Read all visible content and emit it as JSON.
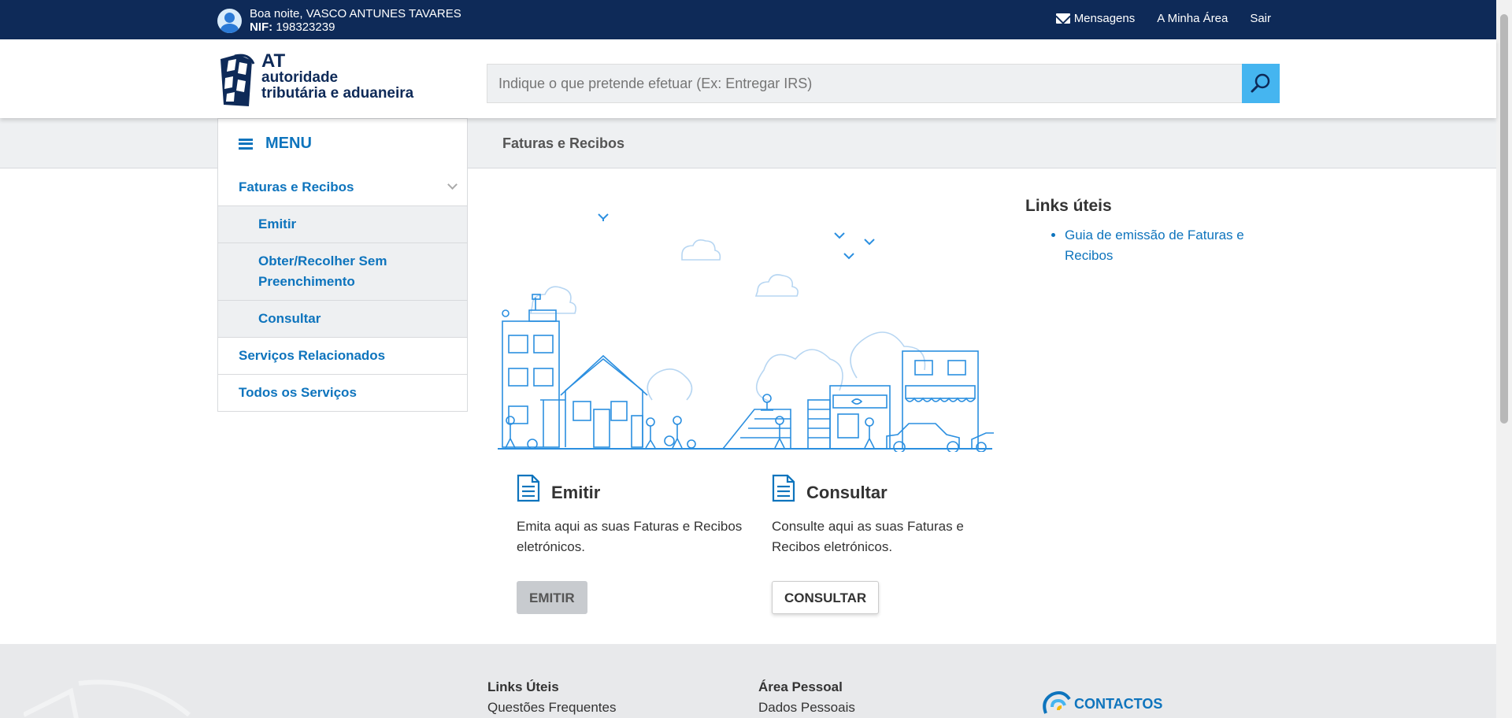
{
  "topbar": {
    "greeting": "Boa noite, VASCO ANTUNES TAVARES",
    "nif_label": "NIF:",
    "nif_value": "198323239",
    "links": {
      "messages": "Mensagens",
      "my_area": "A Minha Área",
      "logout": "Sair"
    }
  },
  "logo": {
    "line1": "AT",
    "line2": "autoridade",
    "line3": "tributária e aduaneira"
  },
  "search": {
    "placeholder": "Indique o que pretende efetuar (Ex: Entregar IRS)"
  },
  "menu": {
    "label": "MENU"
  },
  "breadcrumb": "Faturas e Recibos",
  "sidemenu": [
    {
      "label": "Faturas e Recibos"
    },
    {
      "label": "Emitir"
    },
    {
      "label": "Obter/Recolher Sem Preenchimento"
    },
    {
      "label": "Consultar"
    },
    {
      "label": "Serviços Relacionados"
    },
    {
      "label": "Todos os Serviços"
    }
  ],
  "cards": [
    {
      "title": "Emitir",
      "desc": "Emita aqui as suas Faturas e Recibos eletrónicos.",
      "button": "EMITIR"
    },
    {
      "title": "Consultar",
      "desc": "Consulte aqui as suas Faturas e Recibos eletrónicos.",
      "button": "CONSULTAR"
    }
  ],
  "useful_links": {
    "title": "Links úteis",
    "items": [
      "Guia de emissão de Faturas e Recibos"
    ]
  },
  "footer": {
    "col1": {
      "title": "Links Úteis",
      "item": "Questões Frequentes"
    },
    "col2": {
      "title": "Área Pessoal",
      "item": "Dados Pessoais"
    },
    "contacts": "CONTACTOS"
  },
  "colors": {
    "navy": "#0e2a58",
    "link_blue": "#0e74bd",
    "search_button": "#45b5f0",
    "grey_bg": "#eef0f2"
  }
}
